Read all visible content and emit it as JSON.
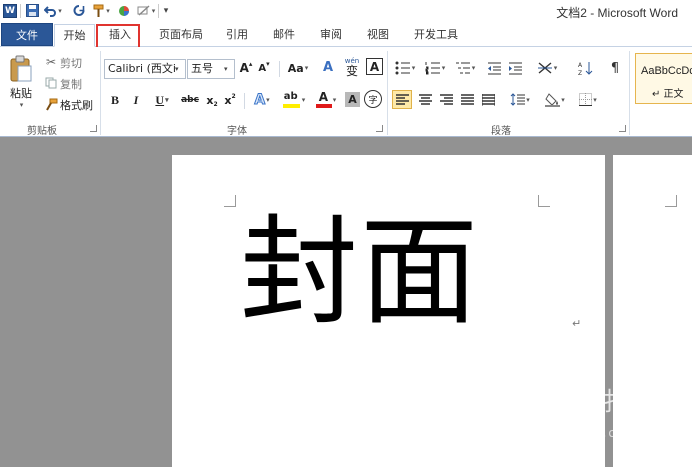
{
  "window": {
    "title": "文档2 - Microsoft Word"
  },
  "quick_access": {
    "app_icon_label": "W",
    "items": [
      "save-icon",
      "undo-icon",
      "redo-icon",
      "format-painter-icon",
      "color-icon",
      "clear-icon",
      "customize-icon"
    ]
  },
  "tabs": [
    "文件",
    "开始",
    "插入",
    "页面布局",
    "引用",
    "邮件",
    "审阅",
    "视图",
    "开发工具"
  ],
  "highlighted_tab": "插入",
  "clipboard": {
    "paste_label": "粘贴",
    "cut_label": "剪切",
    "copy_label": "复制",
    "format_painter_label": "格式刷",
    "group_label": "剪贴板"
  },
  "font": {
    "font_name": "Calibri (西文i",
    "font_size": "五号",
    "grow_label": "A",
    "shrink_label": "A",
    "case_label": "Aa",
    "clear_label": "A",
    "phonetic_label": "wén",
    "phonetic_char": "变",
    "border_label": "A",
    "bold": "B",
    "italic": "I",
    "underline": "U",
    "strike": "abc",
    "subscript": "x",
    "superscript": "x",
    "text_effect": "A",
    "highlight": "ab",
    "font_color": "A",
    "char_shading": "A",
    "enclose": "字",
    "group_label": "字体"
  },
  "paragraph": {
    "group_label": "段落"
  },
  "styles": {
    "sample": "AaBbCcDc",
    "style_name": "↵ 正文"
  },
  "document": {
    "cover_text": "封面",
    "paragraph_mark": "↵"
  },
  "watermark": {
    "main": "搜狗指南",
    "sub": "zhinan.sogou.com",
    "logo": "S"
  },
  "colors": {
    "file_tab": "#2b5797",
    "highlight_box": "#e0342f",
    "ribbon_bg": "#ffffff",
    "doc_bg": "#929292",
    "font_color_bar": "#e01a1a",
    "highlight_bar": "#ffee00"
  }
}
